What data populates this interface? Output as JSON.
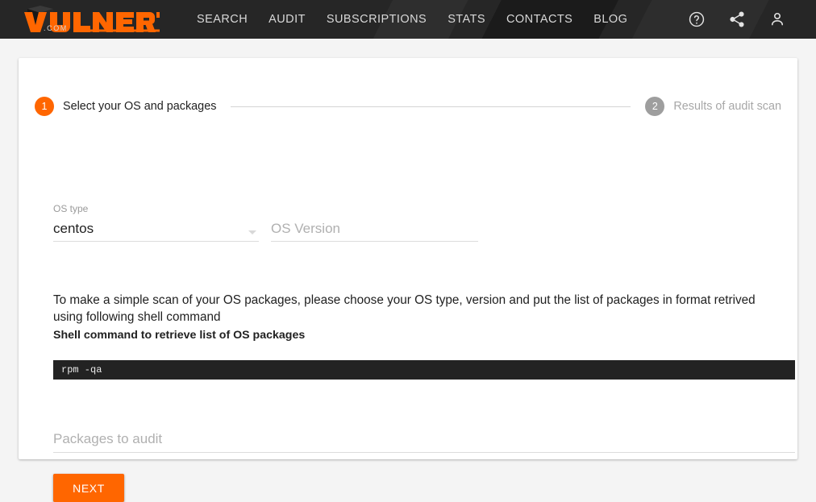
{
  "header": {
    "logo": {
      "name": "vulners-logo",
      "wordmark": "VULNERS",
      "suffix": ".COM"
    },
    "nav": [
      {
        "label": "SEARCH",
        "name": "nav-search"
      },
      {
        "label": "AUDIT",
        "name": "nav-audit"
      },
      {
        "label": "SUBSCRIPTIONS",
        "name": "nav-subscriptions"
      },
      {
        "label": "STATS",
        "name": "nav-stats"
      },
      {
        "label": "CONTACTS",
        "name": "nav-contacts"
      },
      {
        "label": "BLOG",
        "name": "nav-blog"
      }
    ],
    "icons": [
      {
        "name": "help-icon",
        "glyph": "question-circle"
      },
      {
        "name": "share-icon",
        "glyph": "share"
      },
      {
        "name": "account-icon",
        "glyph": "person"
      }
    ]
  },
  "stepper": {
    "steps": [
      {
        "number": "1",
        "label": "Select your OS and packages",
        "state": "active"
      },
      {
        "number": "2",
        "label": "Results of audit scan",
        "state": "inactive"
      }
    ]
  },
  "form": {
    "os_type": {
      "label": "OS type",
      "value": "centos"
    },
    "os_version": {
      "placeholder": "OS Version",
      "value": ""
    },
    "packages": {
      "placeholder": "Packages to audit",
      "value": ""
    },
    "next_button": "NEXT"
  },
  "content": {
    "description": "To make a simple scan of your OS packages, please choose your OS type, version and put the list of packages in format retrived using following shell command",
    "shell_heading": "Shell command to retrieve list of OS packages",
    "shell_command": "rpm -qa"
  },
  "colors": {
    "brand_orange": "#ff6600",
    "header_bg": "#262626",
    "page_bg": "#f4f4f4",
    "code_bg": "#232323",
    "step_inactive": "#9e9e9e"
  }
}
